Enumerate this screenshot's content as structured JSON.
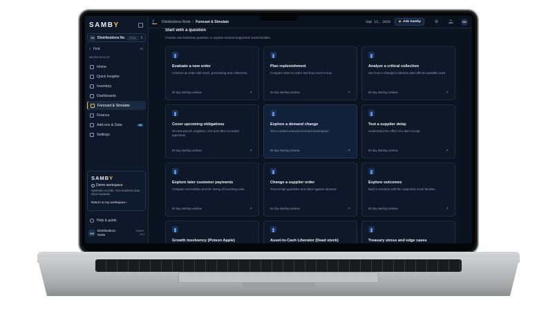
{
  "sidebar": {
    "logo_prefix": "SAMB",
    "logo_suffix": "Y",
    "org": {
      "initials": "DN",
      "name": "Distribuidora No…",
      "badge": "Demo"
    },
    "find": {
      "label": "Find",
      "shortcut": "F"
    },
    "section_label": "WORKSPACE",
    "items": [
      {
        "label": "Home",
        "badge": ""
      },
      {
        "label": "Quick Insights",
        "badge": ""
      },
      {
        "label": "Inventory",
        "badge": ""
      },
      {
        "label": "Dashboards",
        "badge": ""
      },
      {
        "label": "Forecast & Simulate",
        "badge": ""
      },
      {
        "label": "Finance",
        "badge": ""
      },
      {
        "label": "Add-ons & Data",
        "badge": "45"
      },
      {
        "label": "Settings",
        "badge": ""
      }
    ],
    "active_index": 4,
    "demo_card": {
      "brand_prefix": "SAMB",
      "brand_suffix": "Y",
      "title": "Demo workspace",
      "desc": "Synthetic records. Your business data stays separate.",
      "link": "Return to my workspace ›"
    },
    "help": "Help & guide",
    "user": {
      "initials": "DN",
      "name_line1": "Distribuidora",
      "name_line2": "Norte",
      "plan": "SAMBY",
      "version": "v0.4"
    }
  },
  "topbar": {
    "crumb_org": "Distribuidora Norte",
    "crumb_sep": "/",
    "crumb_page": "Forecast & Simulate",
    "date": "Sep 12, 2026",
    "ask_label": "Ask Samby",
    "user_initials": "DN"
  },
  "main": {
    "title": "Start with a question",
    "subtitle": "Choose one business question or explore several supported result families.",
    "cards": [
      {
        "title": "Evaluate a new order",
        "desc": "Connect an order with stock, purchasing and collections.",
        "window": "90 day starting window"
      },
      {
        "title": "Plan replenishment",
        "desc": "Compare when to order and how much to buy.",
        "window": "90 day starting window"
      },
      {
        "title": "Analyze a critical collection",
        "desc": "See how a changed collection date affects available cash.",
        "window": "90 day starting window"
      },
      {
        "title": "Cover upcoming obligations",
        "desc": "Review payroll, suppliers, rent and other recorded payments.",
        "window": "90 day starting window"
      },
      {
        "title": "Explore a demand change",
        "desc": "Test a stated seasonal demand assumption.",
        "window": "90 day starting window"
      },
      {
        "title": "Test a supplier delay",
        "desc": "Understand the effect of a later receipt.",
        "window": "90 day starting window"
      },
      {
        "title": "Explore later customer payments",
        "desc": "Compare receivables and the timing of incoming cash.",
        "window": "90 day starting window"
      },
      {
        "title": "Change a supplier order",
        "desc": "Test receipt quantities and dates against demand.",
        "window": "90 day starting window"
      },
      {
        "title": "Explore outcomes",
        "desc": "Build a scenario with the supported result families.",
        "window": "90 day starting window"
      },
      {
        "title": "Growth insolvency (Poison Apple)",
        "desc": "",
        "window": ""
      },
      {
        "title": "Asset-to-Cash Liberator (Dead stock)",
        "desc": "",
        "window": ""
      },
      {
        "title": "Treasury stress and edge cases",
        "desc": "",
        "window": ""
      }
    ],
    "highlight_index": 4
  },
  "icons": {
    "card_icon": "person-icon",
    "card_arrow": "arrow-up-right-icon",
    "bell": "bell-icon",
    "settings": "gear-icon"
  },
  "colors": {
    "accent_yellow": "#f0c542",
    "accent_blue": "#6ea2ff",
    "background": "#0b1320"
  }
}
